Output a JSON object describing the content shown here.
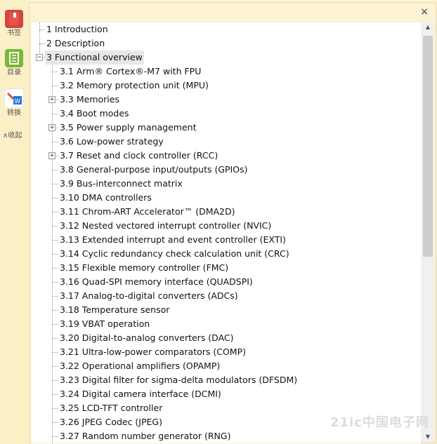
{
  "sidebar": {
    "items": [
      {
        "label": "书签",
        "icon": "bookmark-icon"
      },
      {
        "label": "目录",
        "icon": "toc-icon"
      },
      {
        "label": "转换",
        "icon": "convert-icon"
      }
    ],
    "collapse_label": "∧收起"
  },
  "panel": {
    "close_label": "×"
  },
  "toc": [
    {
      "text": "1 Introduction",
      "level": 0,
      "expander": ""
    },
    {
      "text": "2 Description",
      "level": 0,
      "expander": ""
    },
    {
      "text": "3 Functional overview",
      "level": 0,
      "expander": "−",
      "selected": true
    },
    {
      "text": "3.1 Arm® Cortex®-M7 with FPU",
      "level": 1,
      "expander": ""
    },
    {
      "text": "3.2 Memory protection unit (MPU)",
      "level": 1,
      "expander": ""
    },
    {
      "text": "3.3 Memories",
      "level": 1,
      "expander": "+"
    },
    {
      "text": "3.4 Boot modes",
      "level": 1,
      "expander": ""
    },
    {
      "text": "3.5 Power supply management",
      "level": 1,
      "expander": "+"
    },
    {
      "text": "3.6 Low-power strategy",
      "level": 1,
      "expander": ""
    },
    {
      "text": "3.7 Reset and clock controller (RCC)",
      "level": 1,
      "expander": "+"
    },
    {
      "text": "3.8 General-purpose input/outputs (GPIOs)",
      "level": 1,
      "expander": ""
    },
    {
      "text": "3.9 Bus-interconnect matrix",
      "level": 1,
      "expander": ""
    },
    {
      "text": "3.10 DMA controllers",
      "level": 1,
      "expander": ""
    },
    {
      "text": "3.11 Chrom-ART Accelerator™ (DMA2D)",
      "level": 1,
      "expander": ""
    },
    {
      "text": "3.12 Nested vectored interrupt controller (NVIC)",
      "level": 1,
      "expander": ""
    },
    {
      "text": "3.13 Extended interrupt and event controller (EXTI)",
      "level": 1,
      "expander": ""
    },
    {
      "text": "3.14 Cyclic redundancy check calculation unit (CRC)",
      "level": 1,
      "expander": ""
    },
    {
      "text": "3.15 Flexible memory controller (FMC)",
      "level": 1,
      "expander": ""
    },
    {
      "text": "3.16 Quad-SPI memory interface (QUADSPI)",
      "level": 1,
      "expander": ""
    },
    {
      "text": "3.17 Analog-to-digital converters (ADCs)",
      "level": 1,
      "expander": ""
    },
    {
      "text": "3.18 Temperature sensor",
      "level": 1,
      "expander": ""
    },
    {
      "text": "3.19 VBAT operation",
      "level": 1,
      "expander": ""
    },
    {
      "text": "3.20 Digital-to-analog converters (DAC)",
      "level": 1,
      "expander": ""
    },
    {
      "text": "3.21 Ultra-low-power comparators (COMP)",
      "level": 1,
      "expander": ""
    },
    {
      "text": "3.22 Operational amplifiers (OPAMP)",
      "level": 1,
      "expander": ""
    },
    {
      "text": "3.23 Digital filter for sigma-delta modulators (DFSDM)",
      "level": 1,
      "expander": ""
    },
    {
      "text": "3.24 Digital camera interface (DCMI)",
      "level": 1,
      "expander": ""
    },
    {
      "text": "3.25 LCD-TFT controller",
      "level": 1,
      "expander": ""
    },
    {
      "text": "3.26 JPEG Codec (JPEG)",
      "level": 1,
      "expander": ""
    },
    {
      "text": "3.27 Random number generator (RNG)",
      "level": 1,
      "expander": ""
    }
  ],
  "scrollbar": {
    "up": "▲",
    "down": "▼"
  },
  "watermark": "21ic中国电子网"
}
